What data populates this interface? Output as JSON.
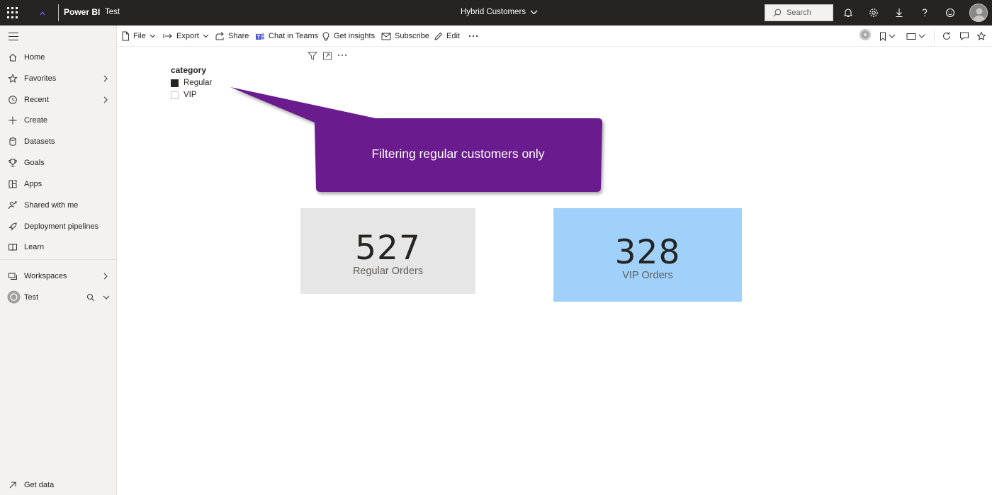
{
  "topbar": {
    "brand": "Power BI",
    "workspace": "Test",
    "report_title": "Hybrid Customers",
    "search_placeholder": "Search"
  },
  "sidebar": {
    "items": [
      {
        "label": "Home",
        "icon": "home-icon"
      },
      {
        "label": "Favorites",
        "icon": "star-icon"
      },
      {
        "label": "Recent",
        "icon": "clock-icon"
      },
      {
        "label": "Create",
        "icon": "plus-icon"
      },
      {
        "label": "Datasets",
        "icon": "database-icon"
      },
      {
        "label": "Goals",
        "icon": "trophy-icon"
      },
      {
        "label": "Apps",
        "icon": "apps-icon"
      },
      {
        "label": "Shared with me",
        "icon": "shared-icon"
      },
      {
        "label": "Deployment pipelines",
        "icon": "rocket-icon"
      },
      {
        "label": "Learn",
        "icon": "book-icon"
      },
      {
        "label": "Workspaces",
        "icon": "workspaces-icon"
      },
      {
        "label": "Test",
        "icon": "workspace-avatar-icon"
      }
    ],
    "get_data": "Get data"
  },
  "toolbar": {
    "file": "File",
    "export": "Export",
    "share": "Share",
    "chat_in_teams": "Chat in Teams",
    "get_insights": "Get insights",
    "subscribe": "Subscribe",
    "edit": "Edit"
  },
  "slicer": {
    "title": "category",
    "options": [
      {
        "label": "Regular",
        "checked": true
      },
      {
        "label": "VIP",
        "checked": false
      }
    ]
  },
  "callout": {
    "text": "Filtering regular customers only",
    "color": "#6a1f8e"
  },
  "cards": {
    "regular": {
      "value": "527",
      "label": "Regular Orders",
      "color": "#e6e6e6"
    },
    "vip": {
      "value": "328",
      "label": "VIP Orders",
      "color": "#a0d1fa"
    }
  }
}
